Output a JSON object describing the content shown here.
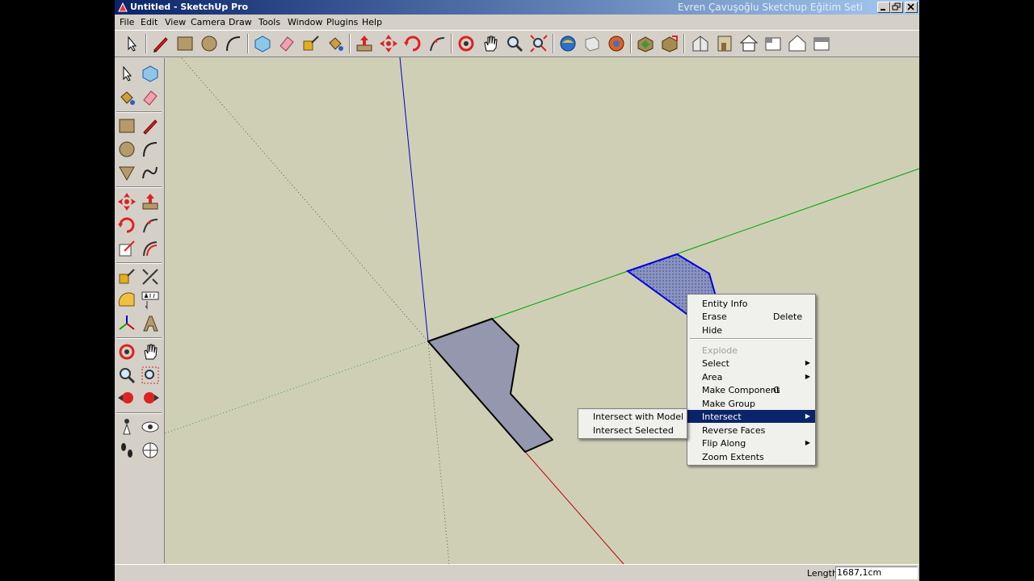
{
  "window": {
    "title": "Untitled - SketchUp Pro",
    "overlay_title": "Evren Çavuşoğlu Sketchup Eğitim Seti"
  },
  "menubar": [
    "File",
    "Edit",
    "View",
    "Camera",
    "Draw",
    "Tools",
    "Window",
    "Plugins",
    "Help"
  ],
  "toolbar_icons": [
    "select-icon",
    "pencil-icon",
    "rectangle-icon",
    "circle-icon",
    "arc-icon",
    "make-component-icon",
    "eraser-icon",
    "tape-measure-icon",
    "paint-bucket-icon",
    "push-pull-icon",
    "move-icon",
    "rotate-icon",
    "follow-me-icon",
    "orbit-icon",
    "pan-icon",
    "zoom-icon",
    "zoom-extents-icon",
    "3d-warehouse-icon",
    "share-model-icon",
    "components-icon",
    "get-models-icon",
    "share-component-icon",
    "iso-view-icon",
    "front-view-icon",
    "top-view-icon",
    "right-view-icon",
    "back-view-icon",
    "left-view-icon"
  ],
  "left_toolbar_icons": [
    "select-icon",
    "make-component-icon",
    "paint-bucket-icon",
    "eraser-icon",
    "rectangle-icon",
    "line-icon",
    "circle-icon",
    "arc-icon",
    "polygon-icon",
    "freehand-icon",
    "move-icon",
    "push-pull-icon",
    "rotate-icon",
    "follow-me-icon",
    "scale-icon",
    "offset-icon",
    "tape-measure-icon",
    "dimension-icon",
    "protractor-icon",
    "text-icon",
    "axes-icon",
    "3d-text-icon",
    "orbit-icon",
    "pan-icon",
    "zoom-icon",
    "zoom-window-icon",
    "previous-view-icon",
    "next-view-icon",
    "position-camera-icon",
    "look-around-icon",
    "walk-icon",
    "section-plane-icon"
  ],
  "context_menu": {
    "items": [
      {
        "label": "Entity Info",
        "shortcut": "",
        "submenu": false,
        "disabled": false
      },
      {
        "label": "Erase",
        "shortcut": "Delete",
        "submenu": false,
        "disabled": false
      },
      {
        "label": "Hide",
        "shortcut": "",
        "submenu": false,
        "disabled": false
      },
      {
        "label": "Explode",
        "shortcut": "",
        "submenu": false,
        "disabled": true
      },
      {
        "label": "Select",
        "shortcut": "",
        "submenu": true,
        "disabled": false
      },
      {
        "label": "Area",
        "shortcut": "",
        "submenu": true,
        "disabled": false
      },
      {
        "label": "Make Component",
        "shortcut": "G",
        "submenu": false,
        "disabled": false
      },
      {
        "label": "Make Group",
        "shortcut": "",
        "submenu": false,
        "disabled": false
      },
      {
        "label": "Intersect",
        "shortcut": "",
        "submenu": true,
        "disabled": false,
        "highlighted": true
      },
      {
        "label": "Reverse Faces",
        "shortcut": "",
        "submenu": false,
        "disabled": false
      },
      {
        "label": "Flip Along",
        "shortcut": "",
        "submenu": true,
        "disabled": false
      },
      {
        "label": "Zoom Extents",
        "shortcut": "",
        "submenu": false,
        "disabled": false
      }
    ]
  },
  "submenu": {
    "items": [
      "Intersect with Model",
      "Intersect Selected"
    ]
  },
  "statusbar": {
    "length_label": "Length",
    "length_value": "1687,1cm"
  },
  "colors": {
    "viewport_bg": "#cfcfb6",
    "face_fill": "#9497ad",
    "selected_face": "#8b94bf",
    "axis_red": "#c00000",
    "axis_green": "#00a000",
    "axis_blue": "#0000cc",
    "highlight": "#0a246a"
  }
}
